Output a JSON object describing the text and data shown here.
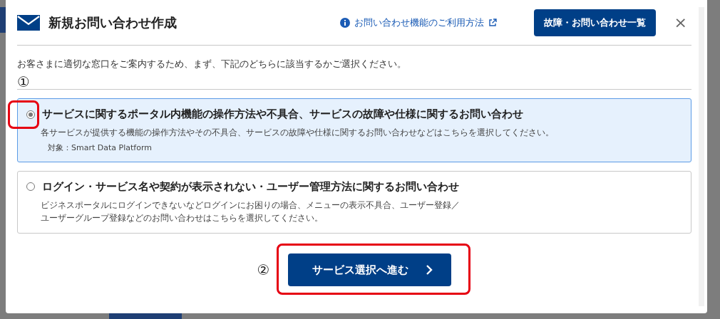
{
  "header": {
    "title": "新規お問い合わせ作成",
    "help_link": "お問い合わせ機能のご利用方法",
    "list_button": "故障・お問い合わせ一覧",
    "close": "×"
  },
  "intro": "お客さまに適切な窓口をご案内するため、まず、下記のどちらに該当するかご選択ください。",
  "step_marker_1": "①",
  "options": [
    {
      "title": "サービスに関するポータル内機能の操作方法や不具合、サービスの故障や仕様に関するお問い合わせ",
      "description": [
        "各サービスが提供する機能の操作方法やその不具合、サービスの故障や仕様に関するお問い合わせなどはこちらを選択してください。"
      ],
      "target": "対象：Smart Data Platform",
      "selected": true,
      "annotated": true
    },
    {
      "title": "ログイン・サービス名や契約が表示されない・ユーザー管理方法に関するお問い合わせ",
      "description": [
        "ビジネスポータルにログインできないなどログインにお困りの場合、メニューの表示不具合、ユーザー登録／",
        "ユーザーグループ登録などのお問い合わせはこちらを選択してください。"
      ],
      "selected": false,
      "annotated": false
    }
  ],
  "step_marker_2": "②",
  "next_button": {
    "label": "サービス選択へ進む",
    "annotated": true
  }
}
